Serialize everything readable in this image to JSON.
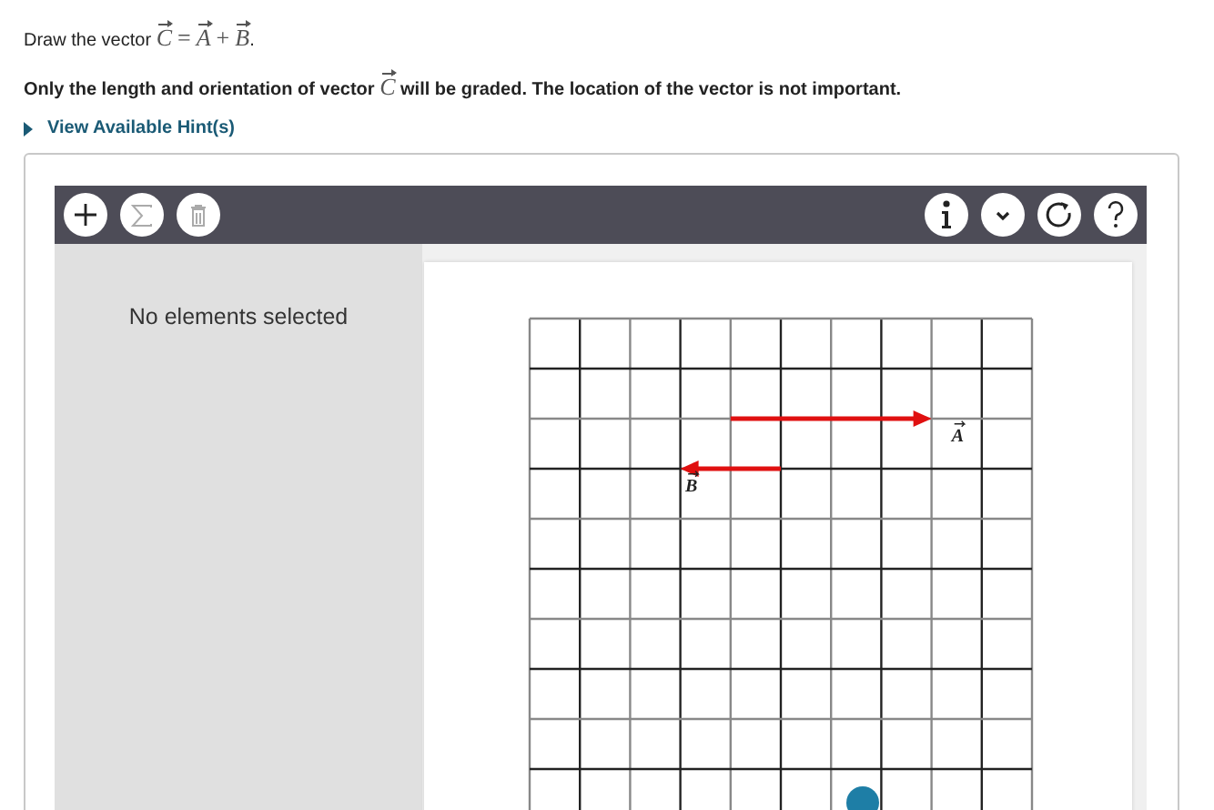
{
  "prompt": {
    "text": "Draw the vector",
    "equation": [
      {
        "symbol": "C",
        "vector": true
      },
      {
        "symbol": "=",
        "vector": false
      },
      {
        "symbol": "A",
        "vector": true
      },
      {
        "symbol": "+",
        "vector": false
      },
      {
        "symbol": "B",
        "vector": true
      }
    ],
    "end": "."
  },
  "instruction": {
    "before": "Only the length and orientation of vector",
    "symbol": {
      "symbol": "C",
      "vector": true
    },
    "after": "will be graded. The location of the vector is not important."
  },
  "hint_link": "View Available Hint(s)",
  "toolbar": {
    "left_tools": [
      {
        "kind": "add",
        "disabled": false
      },
      {
        "kind": "sum",
        "disabled": true
      },
      {
        "kind": "delete",
        "disabled": true
      }
    ],
    "right_tools": [
      {
        "kind": "info",
        "disabled": false
      },
      {
        "kind": "dropdown",
        "disabled": false
      },
      {
        "kind": "reset",
        "disabled": false
      },
      {
        "kind": "help",
        "disabled": false
      }
    ]
  },
  "side_panel": {
    "message": "No elements selected"
  },
  "canvas": {
    "vectors": [
      {
        "label": {
          "symbol": "A",
          "vector": true
        }
      },
      {
        "label": {
          "symbol": "B",
          "vector": true
        }
      }
    ]
  }
}
